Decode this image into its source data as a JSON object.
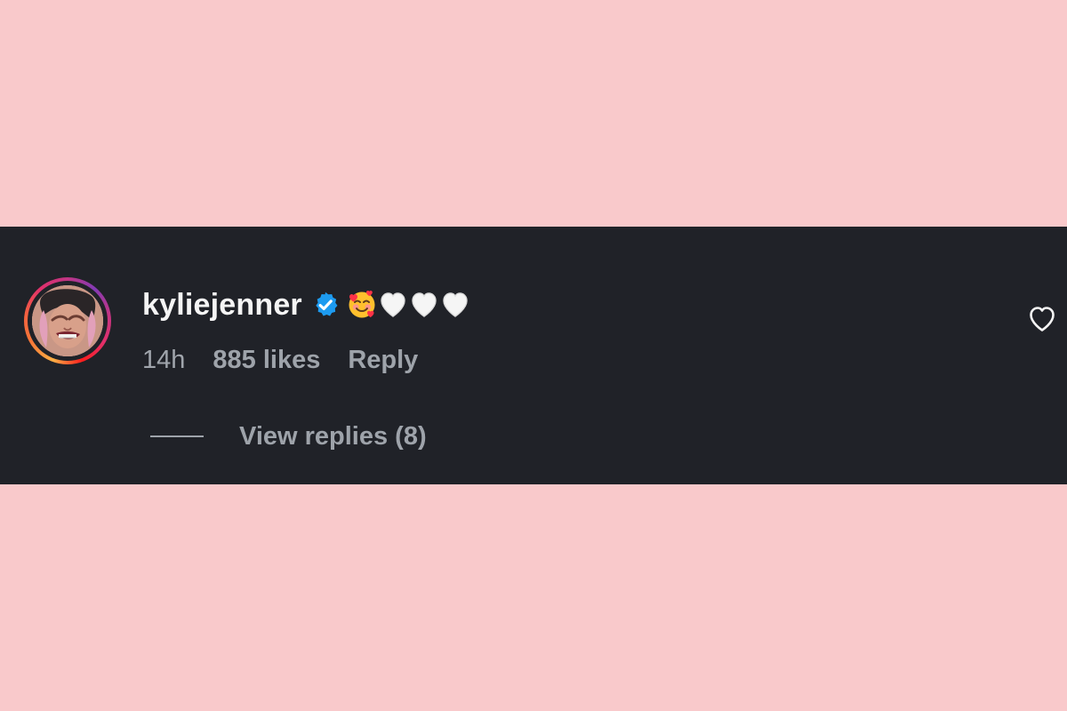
{
  "comment": {
    "username": "kyliejenner",
    "verified": true,
    "emojis": [
      "smiling-face-with-hearts",
      "white-heart",
      "white-heart",
      "white-heart"
    ],
    "time": "14h",
    "likes": "885 likes",
    "reply_label": "Reply",
    "view_replies_label": "View replies (8)"
  },
  "colors": {
    "background": "#f9c9cb",
    "panel": "#202228",
    "username": "#f5f5f5",
    "meta": "#9ea3aa",
    "verified": "#1d9bf0"
  },
  "icons": {
    "verified": "verified-badge-icon",
    "like": "heart-outline-icon"
  }
}
